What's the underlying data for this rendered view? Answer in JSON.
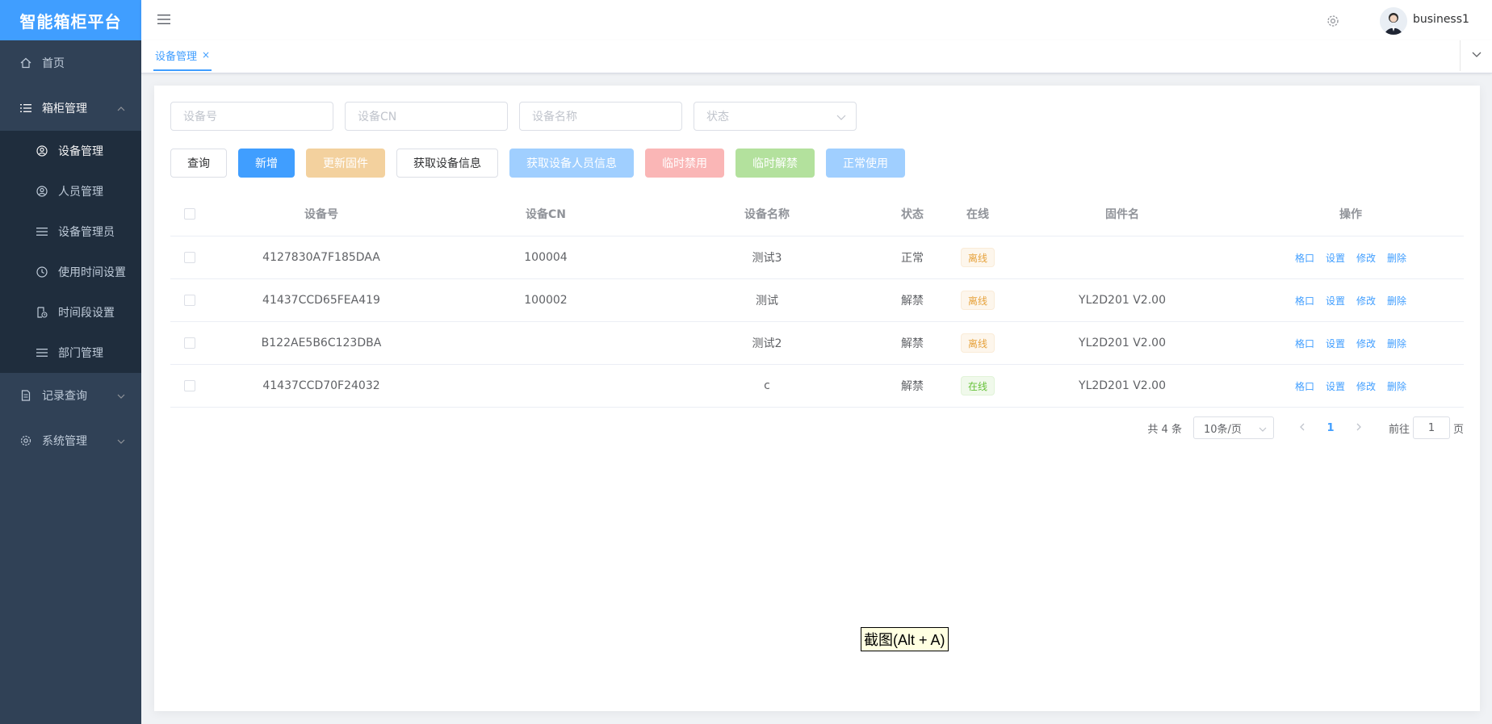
{
  "app": {
    "title": "智能箱柜平台"
  },
  "sidebar": {
    "home": "首页",
    "cabinet": {
      "label": "箱柜管理",
      "items": [
        "设备管理",
        "人员管理",
        "设备管理员",
        "使用时间设置",
        "时间段设置",
        "部门管理"
      ]
    },
    "records": "记录查询",
    "system": "系统管理"
  },
  "header": {
    "username": "business1"
  },
  "tags": {
    "active": "设备管理",
    "close": "×"
  },
  "filters": {
    "device_no": "设备号",
    "device_cn": "设备CN",
    "device_name": "设备名称",
    "status": "状态"
  },
  "buttons": {
    "query": "查询",
    "add": "新增",
    "update_firmware": "更新固件",
    "get_device_info": "获取设备信息",
    "get_device_people": "获取设备人员信息",
    "temp_disable": "临时禁用",
    "temp_enable": "临时解禁",
    "normal_use": "正常使用"
  },
  "table": {
    "headers": [
      "设备号",
      "设备CN",
      "设备名称",
      "状态",
      "在线",
      "固件名",
      "操作"
    ],
    "rows": [
      {
        "no": "4127830A7F185DAA",
        "cn": "100004",
        "name": "测试3",
        "status": "正常",
        "online": "离线",
        "online_state": "off",
        "firmware": ""
      },
      {
        "no": "41437CCD65FEA419",
        "cn": "100002",
        "name": "测试",
        "status": "解禁",
        "online": "离线",
        "online_state": "off",
        "firmware": "YL2D201 V2.00"
      },
      {
        "no": "B122AE5B6C123DBA",
        "cn": "",
        "name": "测试2",
        "status": "解禁",
        "online": "离线",
        "online_state": "off",
        "firmware": "YL2D201 V2.00"
      },
      {
        "no": "41437CCD70F24032",
        "cn": "",
        "name": "c",
        "status": "解禁",
        "online": "在线",
        "online_state": "on",
        "firmware": "YL2D201 V2.00"
      }
    ],
    "ops": [
      "格口",
      "设置",
      "修改",
      "删除"
    ]
  },
  "pagination": {
    "total": "共 4 条",
    "page_size": "10条/页",
    "current": "1",
    "goto": "前往",
    "goto_value": "1",
    "page_suffix": "页"
  },
  "tooltip": "截图(Alt + A)"
}
